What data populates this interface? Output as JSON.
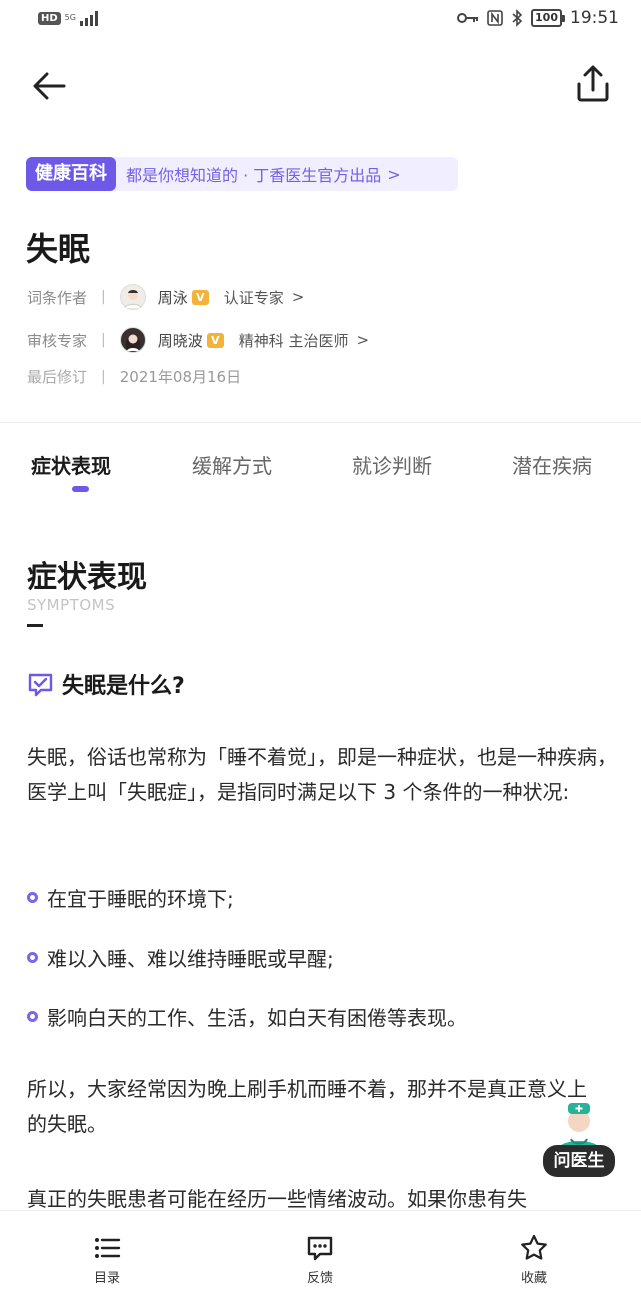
{
  "status_bar": {
    "hd": "HD",
    "network": "5G",
    "battery": "100",
    "time": "19:51"
  },
  "banner": {
    "tag": "健康百科",
    "text": "都是你想知道的 · 丁香医生官方出品",
    "arrow": ">"
  },
  "title": "失眠",
  "meta": {
    "author_label": "词条作者",
    "author_name": "周泳",
    "author_role": "认证专家",
    "reviewer_label": "审核专家",
    "reviewer_name": "周晓波",
    "reviewer_role": "精神科 主治医师",
    "revised_label": "最后修订",
    "revised_date": "2021年08月16日",
    "separator": "|",
    "badge": "V",
    "chevron": ">"
  },
  "tabs": [
    {
      "label": "症状表现",
      "active": true
    },
    {
      "label": "缓解方式",
      "active": false
    },
    {
      "label": "就诊判断",
      "active": false
    },
    {
      "label": "潜在疾病",
      "active": false
    }
  ],
  "section": {
    "title": "症状表现",
    "subtitle": "SYMPTOMS"
  },
  "question": "失眠是什么?",
  "paragraphs": [
    "失眠，俗话也常称为「睡不着觉」，即是一种症状，也是一种疾病，医学上叫「失眠症」，是指同时满足以下 3 个条件的一种状况:",
    "所以，大家经常因为晚上刷手机而睡不着，那并不是真正意义上的失眠。",
    "真正的失眠患者可能在经历一些情绪波动。如果你患有失"
  ],
  "bullets": [
    "在宜于睡眠的环境下;",
    "难以入睡、难以维持睡眠或早醒;",
    "影响白天的工作、生活，如白天有困倦等表现。"
  ],
  "floating": {
    "ask_doctor": "问医生"
  },
  "bottom_bar": {
    "toc": "目录",
    "feedback": "反馈",
    "favorite": "收藏"
  },
  "colors": {
    "accent": "#6e58e8",
    "badge": "#f3b23a"
  }
}
